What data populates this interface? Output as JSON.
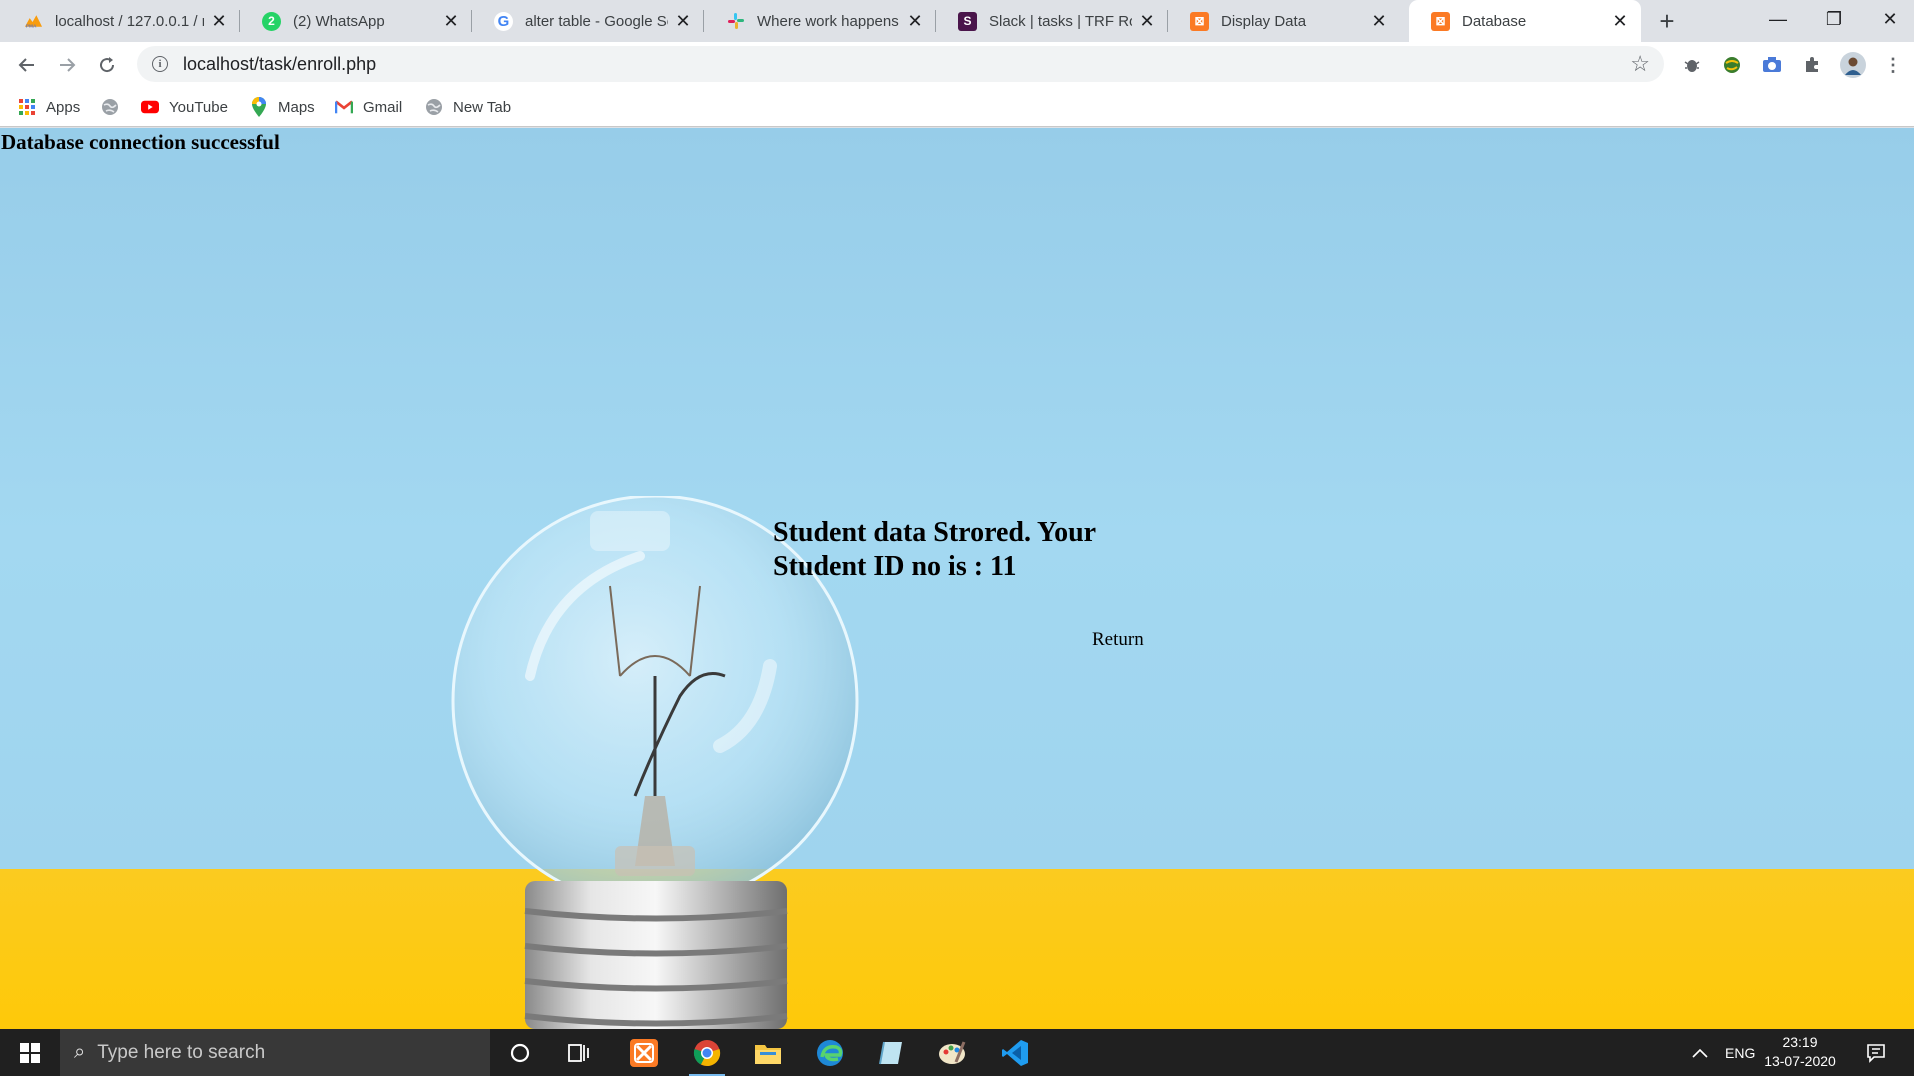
{
  "browser": {
    "tabs": [
      {
        "title": "localhost / 127.0.0.1 / n",
        "icon": "phpmyadmin-icon",
        "color": "#f89c0e"
      },
      {
        "title": "(2) WhatsApp",
        "icon": "whatsapp-icon",
        "color": "#25d366"
      },
      {
        "title": "alter table - Google Se",
        "icon": "google-icon",
        "color": "#4285f4"
      },
      {
        "title": "Where work happens |",
        "icon": "slack-icon",
        "color": "#e01e5a"
      },
      {
        "title": "Slack | tasks | TRF Robo",
        "icon": "slack-workspace-icon",
        "color": "#4a154b"
      },
      {
        "title": "Display Data",
        "icon": "xampp-icon",
        "color": "#fb7a24"
      },
      {
        "title": "Database",
        "icon": "xampp-icon",
        "color": "#fb7a24"
      }
    ],
    "active_tab": 6,
    "url": "localhost/task/enroll.php",
    "bookmarks": [
      {
        "label": "Apps",
        "icon": "apps-grid-icon"
      },
      {
        "label": "",
        "icon": "globe-icon"
      },
      {
        "label": "YouTube",
        "icon": "youtube-icon"
      },
      {
        "label": "Maps",
        "icon": "maps-pin-icon"
      },
      {
        "label": "Gmail",
        "icon": "gmail-icon"
      },
      {
        "label": "New Tab",
        "icon": "globe-icon"
      }
    ]
  },
  "page": {
    "connection_status": "Database connection successful",
    "message": "Student data Strored. Your Student ID no is : 11",
    "return_link": "Return"
  },
  "taskbar": {
    "search_placeholder": "Type here to search",
    "language": "ENG",
    "time": "23:19",
    "date": "13-07-2020"
  },
  "colors": {
    "wall": "#9fd4ee",
    "floor": "#fec909",
    "taskbar": "#202020",
    "tabstrip": "#dee1e6"
  }
}
